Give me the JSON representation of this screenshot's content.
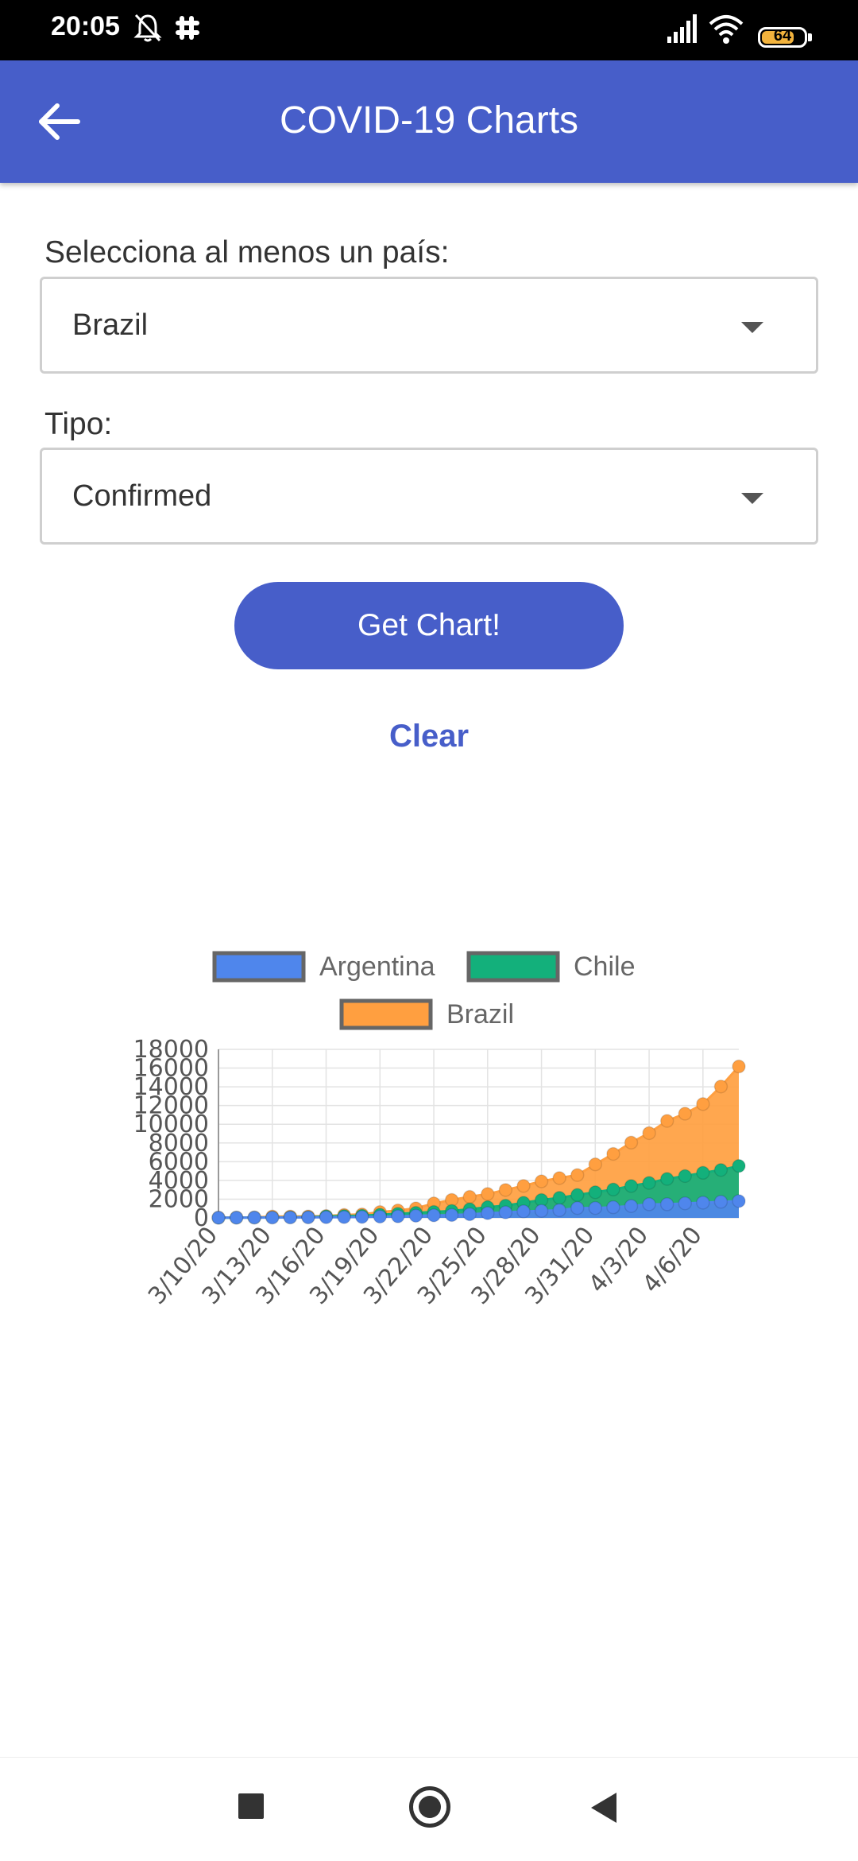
{
  "status_bar": {
    "time": "20:05",
    "battery": "64"
  },
  "app_bar": {
    "title": "COVID-19 Charts"
  },
  "form": {
    "country_label": "Selecciona al menos un país:",
    "country_value": "Brazil",
    "type_label": "Tipo:",
    "type_value": "Confirmed",
    "get_chart": "Get Chart!",
    "clear": "Clear"
  },
  "chart_data": {
    "type": "area",
    "categories": [
      "3/10/20",
      "3/11/20",
      "3/12/20",
      "3/13/20",
      "3/14/20",
      "3/15/20",
      "3/16/20",
      "3/17/20",
      "3/18/20",
      "3/19/20",
      "3/20/20",
      "3/21/20",
      "3/22/20",
      "3/23/20",
      "3/24/20",
      "3/25/20",
      "3/26/20",
      "3/27/20",
      "3/28/20",
      "3/29/20",
      "3/30/20",
      "3/31/20",
      "4/1/20",
      "4/2/20",
      "4/3/20",
      "4/4/20",
      "4/5/20",
      "4/6/20",
      "4/7/20",
      "4/8/20"
    ],
    "tick_labels": [
      "3/10/20",
      "3/13/20",
      "3/16/20",
      "3/19/20",
      "3/22/20",
      "3/25/20",
      "3/28/20",
      "3/31/20",
      "4/3/20",
      "4/6/20"
    ],
    "ylim": [
      0,
      18000
    ],
    "y_ticks": [
      0,
      2000,
      4000,
      6000,
      8000,
      10000,
      12000,
      14000,
      16000,
      18000
    ],
    "grid": true,
    "legend_position": "top",
    "series": [
      {
        "name": "Argentina",
        "color": "#4f86ec",
        "values": [
          17,
          19,
          31,
          34,
          45,
          56,
          65,
          79,
          97,
          128,
          158,
          225,
          266,
          301,
          387,
          502,
          589,
          690,
          745,
          820,
          1054,
          1054,
          1133,
          1265,
          1451,
          1451,
          1554,
          1628,
          1715,
          1795
        ]
      },
      {
        "name": "Chile",
        "color": "#13b07b",
        "values": [
          13,
          23,
          33,
          43,
          61,
          74,
          155,
          201,
          238,
          342,
          434,
          537,
          632,
          746,
          922,
          1142,
          1306,
          1610,
          1909,
          2139,
          2449,
          2738,
          3031,
          3404,
          3737,
          4161,
          4471,
          4815,
          5116,
          5546
        ]
      },
      {
        "name": "Brazil",
        "color": "#ff9f40",
        "values": [
          31,
          38,
          52,
          151,
          151,
          162,
          200,
          321,
          372,
          621,
          793,
          1021,
          1546,
          1924,
          2247,
          2554,
          2985,
          3417,
          3904,
          4256,
          4579,
          5717,
          6836,
          8044,
          9056,
          10360,
          11130,
          12161,
          14034,
          16170
        ]
      }
    ]
  }
}
